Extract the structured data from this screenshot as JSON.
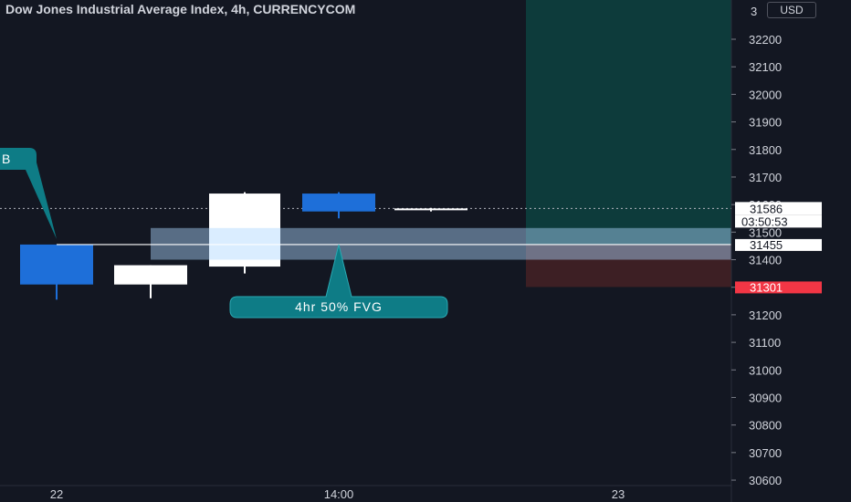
{
  "header": {
    "title": "Dow Jones Industrial Average Index, 4h, CURRENCYCOM",
    "currency": "USD"
  },
  "price_axis": {
    "ticks": [
      "32200",
      "32100",
      "32000",
      "31900",
      "31800",
      "31700",
      "31600",
      "31500",
      "31400",
      "31300",
      "31200",
      "31100",
      "31000",
      "30900",
      "30800",
      "30700",
      "30600"
    ],
    "top_label_partial": "3",
    "labels": {
      "current_price": "31586",
      "countdown": "03:50:53",
      "line_price": "31455",
      "stop_price": "31301"
    }
  },
  "time_axis": {
    "labels": [
      "22",
      "14:00",
      "23"
    ]
  },
  "annotations": {
    "left_label": "B",
    "fvg_label": "4hr 50% FVG"
  },
  "colors": {
    "background": "#131722",
    "bearish_candle": "#1e6fd9",
    "bullish_candle": "#ffffff",
    "callout": "#0e7c86",
    "target_zone": "#0d3b3b",
    "stop_zone": "#3d1f24",
    "stop_label": "#f23645"
  },
  "chart_data": {
    "type": "candlestick",
    "title": "Dow Jones Industrial Average Index, 4h, CURRENCYCOM",
    "x_labels": [
      "22",
      "14:00",
      "23"
    ],
    "ylim": [
      30560,
      32260
    ],
    "candles": [
      {
        "open": 31455,
        "high": 31455,
        "low": 31255,
        "close": 31310
      },
      {
        "open": 31310,
        "high": 31380,
        "low": 31260,
        "close": 31380
      },
      {
        "open": 31375,
        "high": 31645,
        "low": 31350,
        "close": 31640
      },
      {
        "open": 31640,
        "high": 31645,
        "low": 31550,
        "close": 31575
      },
      {
        "open": 31586,
        "high": 31588,
        "low": 31575,
        "close": 31586
      }
    ],
    "fvg_zone": [
      31400,
      31515
    ],
    "horizontal_line": 31455,
    "current_price": 31586,
    "position": {
      "entry": 31455,
      "target": 32260,
      "stop": 31301
    }
  }
}
